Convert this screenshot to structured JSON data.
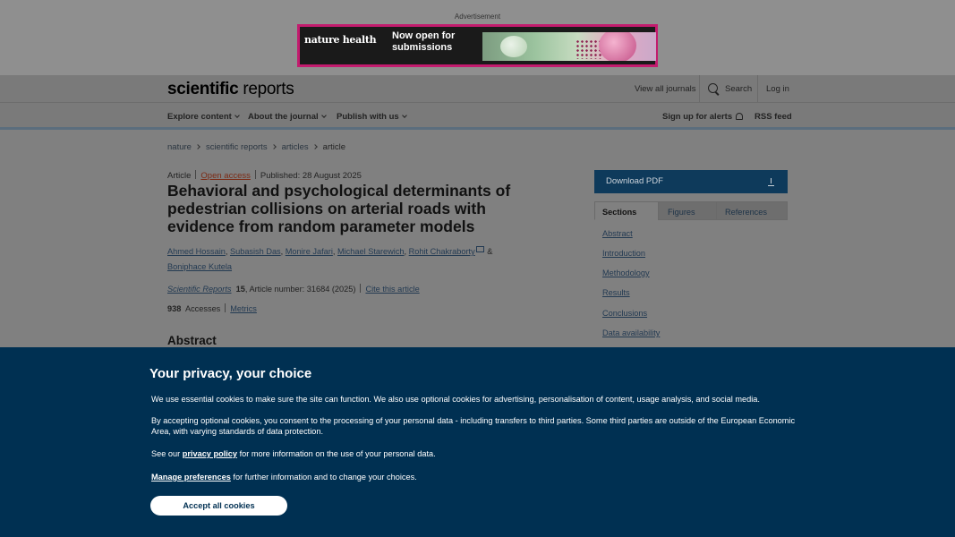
{
  "ad": {
    "label": "Advertisement",
    "brand": "nature health",
    "headline_line1": "Now open for",
    "headline_line2": "submissions"
  },
  "header": {
    "logo_bold": "scientific",
    "logo_light": " reports",
    "view_all": "View all journals",
    "search": "Search",
    "login": "Log in"
  },
  "nav": {
    "explore": "Explore content",
    "about": "About the journal",
    "publish": "Publish with us",
    "alerts": "Sign up for alerts",
    "rss": "RSS feed"
  },
  "breadcrumb": [
    "nature",
    "scientific reports",
    "articles",
    "article"
  ],
  "article": {
    "type": "Article",
    "open_access": "Open access",
    "published": "Published: 28 August 2025",
    "title": "Behavioral and psychological determinants of pedestrian collisions on arterial roads with evidence from random parameter models",
    "authors": [
      "Ahmed Hossain",
      "Subasish Das",
      "Monire Jafari",
      "Michael Starewich",
      "Rohit Chakraborty"
    ],
    "author_last": "Boniphace Kutela",
    "journal": "Scientific Reports",
    "volume": "15",
    "article_number": ", Article number: 31684 (2025)",
    "cite": "Cite this article",
    "accesses_count": "938",
    "accesses_label": "Accesses",
    "metrics": "Metrics",
    "abstract_heading": "Abstract"
  },
  "sidebar": {
    "download": "Download PDF",
    "tabs": [
      "Sections",
      "Figures",
      "References"
    ],
    "sections": [
      "Abstract",
      "Introduction",
      "Methodology",
      "Results",
      "Conclusions",
      "Data availability"
    ]
  },
  "cookie": {
    "title": "Your privacy, your choice",
    "p1": "We use essential cookies to make sure the site can function. We also use optional cookies for advertising, personalisation of content, usage analysis, and social media.",
    "p2": "By accepting optional cookies, you consent to the processing of your personal data - including transfers to third parties. Some third parties are outside of the European Economic Area, with varying standards of data protection.",
    "p3_pre": "See our ",
    "p3_link": "privacy policy",
    "p3_post": " for more information on the use of your personal data.",
    "p4_link": "Manage preferences",
    "p4_post": " for further information and to change your choices.",
    "accept": "Accept all cookies"
  },
  "colors": {
    "cookie_bg": "#003052",
    "pdf_button": "#0e3a5b",
    "ad_border": "#c31b6e"
  }
}
